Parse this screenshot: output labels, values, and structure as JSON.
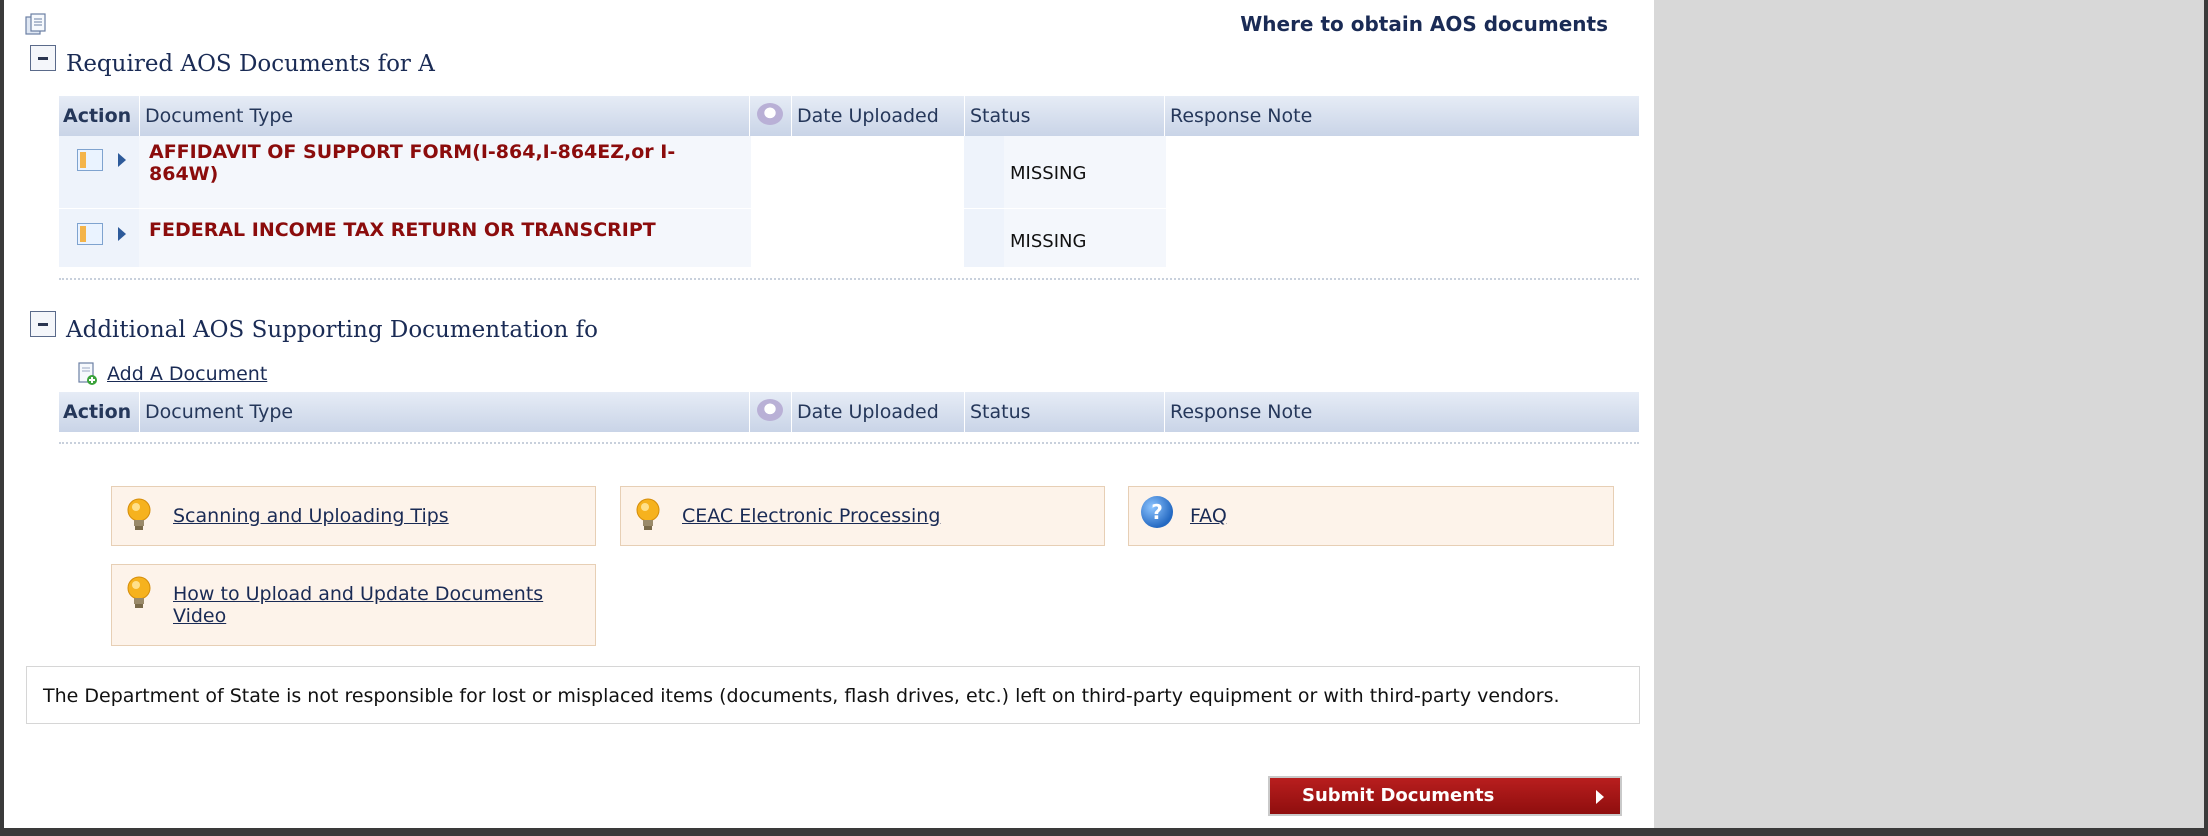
{
  "header": {
    "where_link": "Where to obtain AOS documents"
  },
  "required_section": {
    "title": "Required AOS Documents for A",
    "columns": {
      "action": "Action",
      "document_type": "Document Type",
      "date_uploaded": "Date Uploaded",
      "status": "Status",
      "response_note": "Response Note"
    },
    "rows": [
      {
        "document_type_line1": "AFFIDAVIT OF SUPPORT FORM(I-864,I-864EZ,or I-",
        "document_type_line2": "864W)",
        "status": "MISSING"
      },
      {
        "document_type_line1": "FEDERAL INCOME TAX RETURN OR TRANSCRIPT",
        "document_type_line2": "",
        "status": "MISSING"
      }
    ]
  },
  "additional_section": {
    "title": "Additional AOS Supporting Documentation fo",
    "add_document_label": "Add A Document",
    "columns": {
      "action": "Action",
      "document_type": "Document Type",
      "date_uploaded": "Date Uploaded",
      "status": "Status",
      "response_note": "Response Note"
    }
  },
  "tips": [
    {
      "label": "Scanning and Uploading Tips",
      "icon": "lightbulb-icon"
    },
    {
      "label": "CEAC Electronic Processing",
      "icon": "lightbulb-icon"
    },
    {
      "label": "FAQ",
      "icon": "question-icon"
    },
    {
      "label_line1": "How to Upload and Update Documents",
      "label_line2": "Video",
      "icon": "lightbulb-icon"
    }
  ],
  "disclaimer": "The Department of State is not responsible for lost or misplaced items (documents, flash drives, etc.) left on third-party equipment or with third-party vendors.",
  "submit_label": "Submit Documents",
  "faq_glyph": "?"
}
